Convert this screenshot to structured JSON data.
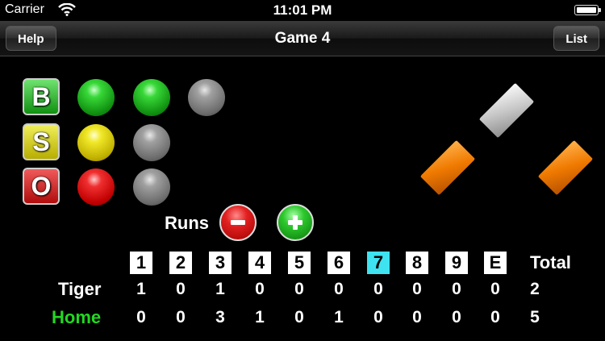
{
  "status_bar": {
    "carrier": "Carrier",
    "time": "11:01 PM"
  },
  "nav": {
    "title": "Game 4",
    "left_button": "Help",
    "right_button": "List"
  },
  "count": {
    "balls_label": "B",
    "strikes_label": "S",
    "outs_label": "O",
    "balls": 2,
    "balls_max": 3,
    "strikes": 1,
    "strikes_max": 2,
    "outs": 1,
    "outs_max": 2
  },
  "bases": {
    "first": true,
    "second": false,
    "third": true
  },
  "runs": {
    "label": "Runs"
  },
  "scoreboard": {
    "innings": [
      "1",
      "2",
      "3",
      "4",
      "5",
      "6",
      "7",
      "8",
      "9",
      "E"
    ],
    "current_inning": "7",
    "total_label": "Total",
    "teams": [
      {
        "name": "Tiger",
        "scores": [
          "1",
          "0",
          "1",
          "0",
          "0",
          "0",
          "0",
          "0",
          "0",
          "0"
        ],
        "total": "2"
      },
      {
        "name": "Home",
        "scores": [
          "0",
          "0",
          "3",
          "1",
          "0",
          "1",
          "0",
          "0",
          "0",
          "0"
        ],
        "total": "5"
      }
    ]
  },
  "colors": {
    "current_inning": "#3ee3ef",
    "home_team": "#22d822"
  }
}
